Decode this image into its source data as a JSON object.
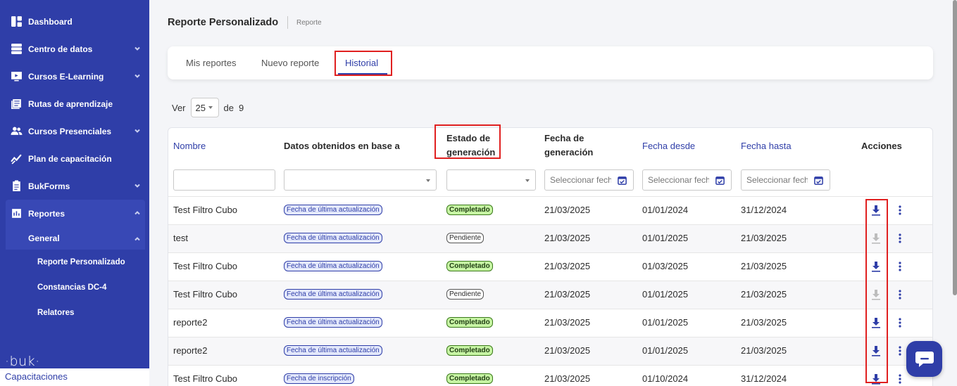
{
  "sidebar": {
    "items": [
      {
        "label": "Dashboard",
        "icon": "dashboard-icon"
      },
      {
        "label": "Centro de datos",
        "icon": "server-icon"
      },
      {
        "label": "Cursos E-Learning",
        "icon": "monitor-play-icon"
      },
      {
        "label": "Rutas de aprendizaje",
        "icon": "book-list-icon"
      },
      {
        "label": "Cursos Presenciales",
        "icon": "people-icon"
      },
      {
        "label": "Plan de capacitación",
        "icon": "chart-line-icon"
      },
      {
        "label": "BukForms",
        "icon": "clipboard-icon"
      },
      {
        "label": "Reportes",
        "icon": "report-icon"
      }
    ],
    "sub_group": "General",
    "leaves": [
      "Reporte Personalizado",
      "Constancias DC-4",
      "Relatores"
    ],
    "logo": "·buk·",
    "app_label": "Capacitaciones"
  },
  "header": {
    "title": "Reporte Personalizado",
    "breadcrumb": "Reporte"
  },
  "tabs": [
    "Mis reportes",
    "Nuevo reporte",
    "Historial"
  ],
  "pager": {
    "prefix": "Ver",
    "page_size": "25",
    "of_label": "de",
    "total": "9"
  },
  "table": {
    "headers": {
      "nombre": "Nombre",
      "datos": "Datos obtenidos en base a",
      "estado_1": "Estado de",
      "estado_2": "generación",
      "fecha_gen_1": "Fecha de",
      "fecha_gen_2": "generación",
      "desde": "Fecha desde",
      "hasta": "Fecha hasta",
      "acciones": "Acciones"
    },
    "date_placeholder": "Seleccionar fecha",
    "rows": [
      {
        "nombre": "Test Filtro Cubo",
        "datos": "Fecha de última actualización",
        "estado": "Completado",
        "fecha": "21/03/2025",
        "desde": "01/01/2024",
        "hasta": "31/12/2024"
      },
      {
        "nombre": "test",
        "datos": "Fecha de última actualización",
        "estado": "Pendiente",
        "fecha": "21/03/2025",
        "desde": "01/01/2025",
        "hasta": "21/03/2025"
      },
      {
        "nombre": "Test Filtro Cubo",
        "datos": "Fecha de última actualización",
        "estado": "Completado",
        "fecha": "21/03/2025",
        "desde": "01/03/2025",
        "hasta": "21/03/2025"
      },
      {
        "nombre": "Test Filtro Cubo",
        "datos": "Fecha de última actualización",
        "estado": "Pendiente",
        "fecha": "21/03/2025",
        "desde": "01/01/2025",
        "hasta": "21/03/2025"
      },
      {
        "nombre": "reporte2",
        "datos": "Fecha de última actualización",
        "estado": "Completado",
        "fecha": "21/03/2025",
        "desde": "01/01/2025",
        "hasta": "21/03/2025"
      },
      {
        "nombre": "reporte2",
        "datos": "Fecha de última actualización",
        "estado": "Completado",
        "fecha": "21/03/2025",
        "desde": "01/01/2025",
        "hasta": "21/03/2025"
      },
      {
        "nombre": "Test Filtro Cubo",
        "datos": "Fecha de inscripción",
        "estado": "Completado",
        "fecha": "21/03/2025",
        "desde": "01/10/2024",
        "hasta": "31/12/2024"
      }
    ]
  },
  "colors": {
    "primary": "#2f3ea8",
    "highlight": "#e02020",
    "completed_bg": "#c7f5a4"
  }
}
